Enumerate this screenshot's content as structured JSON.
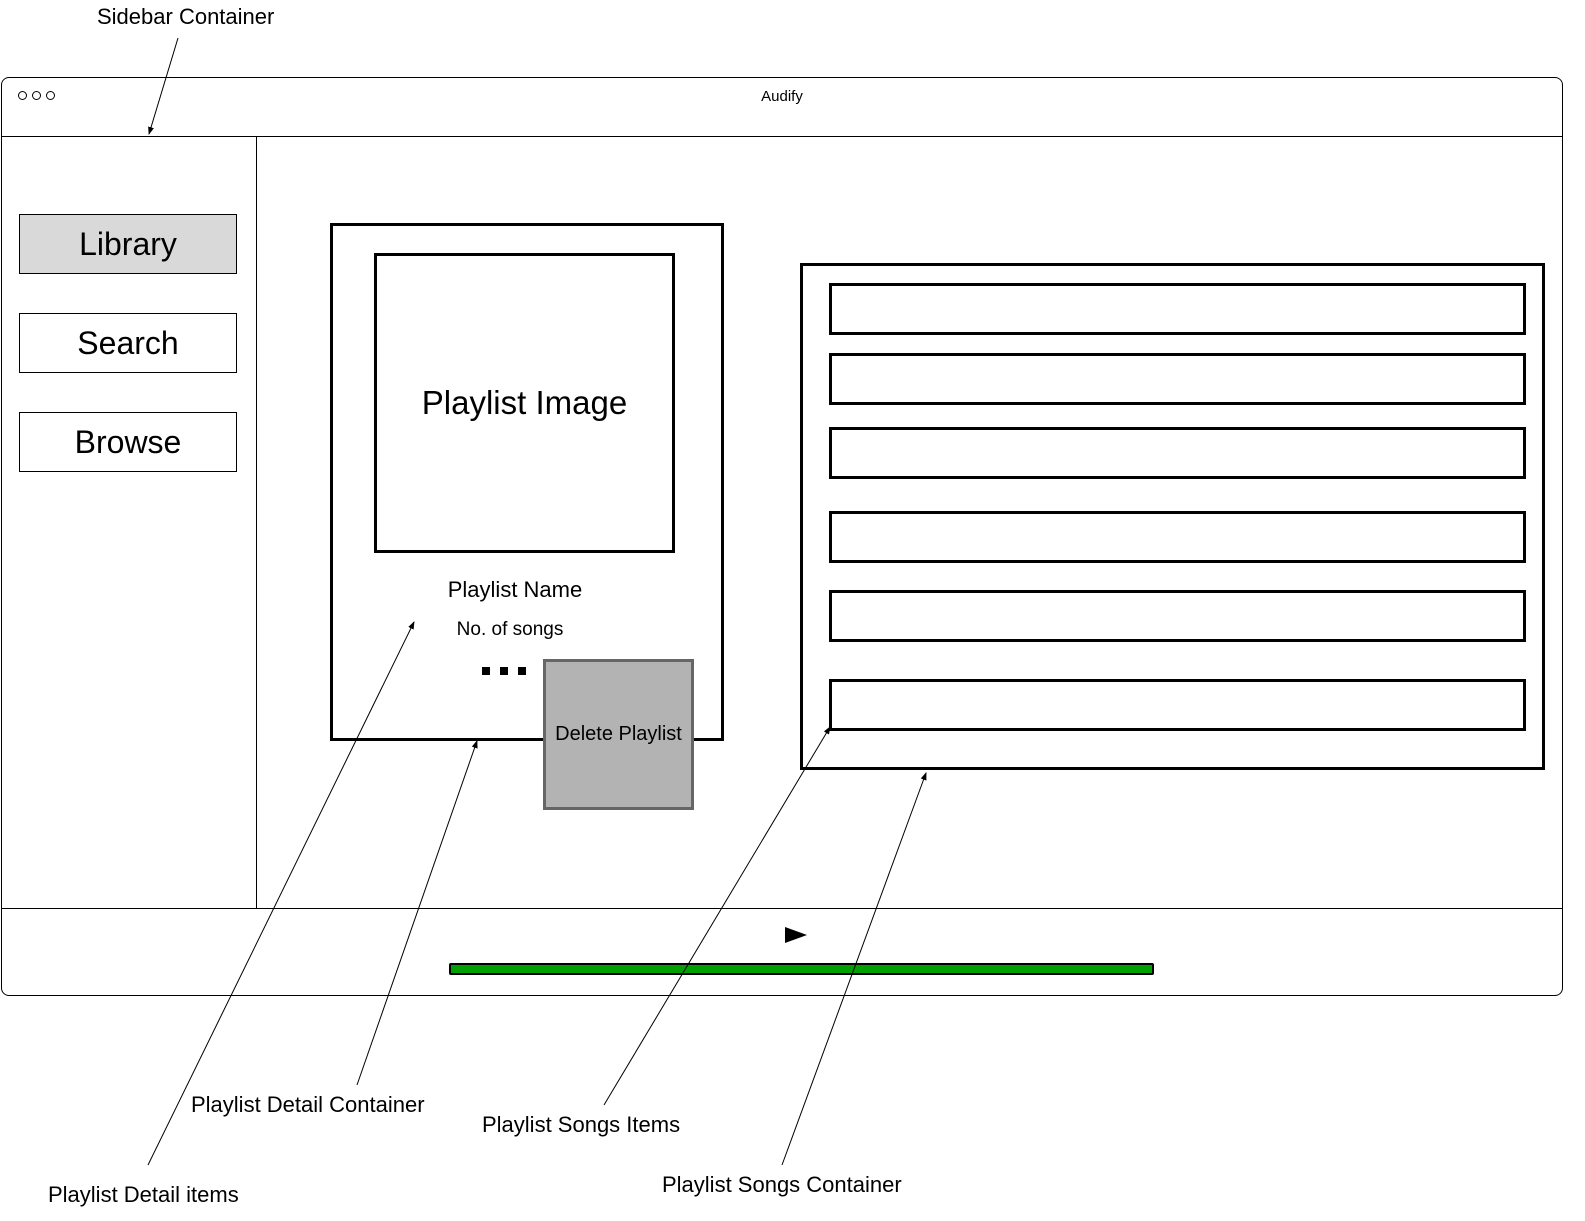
{
  "window": {
    "title": "Audify"
  },
  "sidebar": {
    "items": [
      {
        "label": "Library",
        "active": true
      },
      {
        "label": "Search",
        "active": false
      },
      {
        "label": "Browse",
        "active": false
      }
    ]
  },
  "playlist_detail": {
    "image_label": "Playlist Image",
    "name": "Playlist Name",
    "song_count": "No. of songs",
    "delete_button": "Delete Playlist"
  },
  "player": {
    "progress": 1.0,
    "progress_color": "#00a000"
  },
  "annotations": {
    "sidebar_container": "Sidebar Container",
    "playlist_detail_container": "Playlist Detail Container",
    "playlist_songs_items": "Playlist Songs Items",
    "playlist_songs_container": "Playlist Songs Container",
    "playlist_detail_items": "Playlist Detail items"
  },
  "colors": {
    "active_nav": "#d9d9d9",
    "delete_button": "#b3b3b3",
    "progress": "#00a000"
  }
}
